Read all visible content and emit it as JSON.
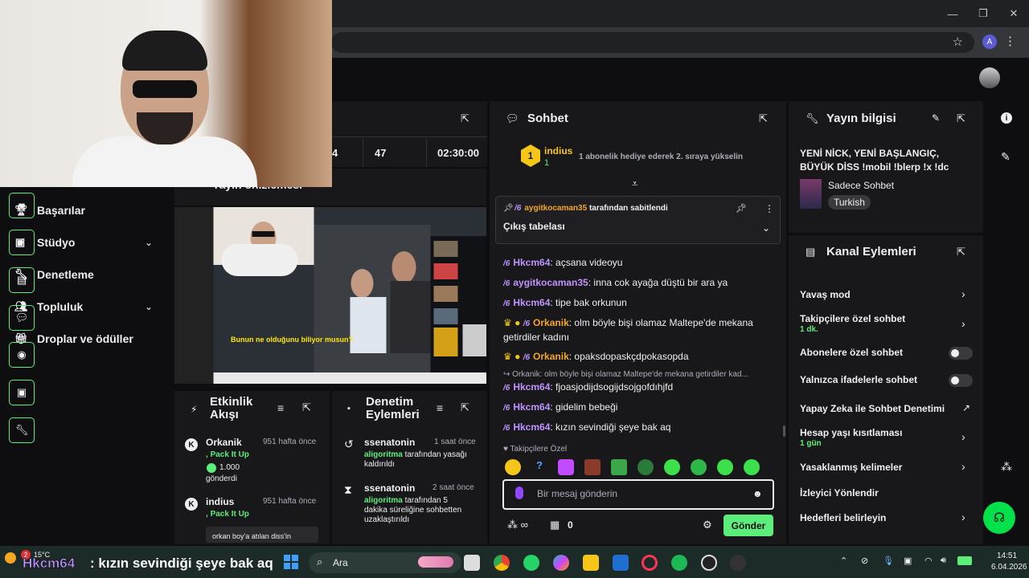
{
  "browser": {
    "window_buttons": [
      "—",
      "❐",
      "✕"
    ],
    "profile_initial": "A"
  },
  "sidebar": {
    "items": [
      {
        "label": "Başarılar",
        "icon": "trophy-icon"
      },
      {
        "label": "Stüdyo",
        "icon": "studio-icon",
        "expandable": true
      },
      {
        "label": "Denetleme",
        "icon": "wrench-icon"
      },
      {
        "label": "Topluluk",
        "icon": "community-icon",
        "expandable": true
      },
      {
        "label": "Droplar ve ödüller",
        "icon": "drops-icon"
      }
    ]
  },
  "stats": {
    "a": "4",
    "b": "47",
    "uptime": "02:30:00"
  },
  "preview": {
    "title_partial": "Yayın önizlemesi",
    "subtitle": "Bunun ne olduğunu biliyor musun?"
  },
  "activity": {
    "title": "Etkinlik Akışı",
    "items": [
      {
        "user": "Orkanik",
        "time": "951 hafta önce",
        "action": "Pack It Up",
        "amount": "1.000",
        "verb": "gönderdi"
      },
      {
        "user": "indius",
        "time": "951 hafta önce",
        "action": "Pack It Up",
        "note": "orkan boy'a atılan diss'in"
      }
    ]
  },
  "mod_actions": {
    "title": "Denetim Eylemleri",
    "items": [
      {
        "user": "ssenatonin",
        "time": "1 saat önce",
        "mod": "aligoritma",
        "text": "tarafından yasağı kaldırıldı"
      },
      {
        "user": "ssenatonin",
        "time": "2 saat önce",
        "mod": "aligoritma",
        "text": "tarafından 5 dakika süreliğine sohbetten uzaklaştırıldı"
      }
    ]
  },
  "chat": {
    "title": "Sohbet",
    "top_gifter": {
      "rank": "1",
      "user": "indius",
      "count": "1",
      "hint": "1 abonelik hediye ederek 2. sıraya yükselin"
    },
    "pinned": {
      "by_user": "aygitkocaman35",
      "by_text": "tarafından sabitlendi",
      "message": "Çıkış tabelası"
    },
    "messages": [
      {
        "user": "Hkcm64",
        "color": "#bf94ff",
        "text": "açsana videoyu",
        "badges": "tw"
      },
      {
        "user": "aygitkocaman35",
        "color": "#bf94ff",
        "text": "inna cok ayağa düştü bir ara ya",
        "badges": "tw"
      },
      {
        "user": "Hkcm64",
        "color": "#bf94ff",
        "text": "tipe bak orkunun",
        "badges": "tw"
      },
      {
        "user": "Orkanik",
        "color": "#f5a623",
        "text": "olm böyle bişi olamaz Maltepe'de mekana getirdiler kadını",
        "badges": "crown"
      },
      {
        "user": "Orkanik",
        "color": "#f5a623",
        "text": "opaksdopaskçdpokasopda",
        "badges": "crown"
      },
      {
        "reply": "Orkanik: olm böyle bişi olamaz Maltepe'de mekana getirdiler kad..."
      },
      {
        "user": "Hkcm64",
        "color": "#bf94ff",
        "text": "fjoasjodijdsogijdsojgofdıhjfd",
        "badges": "tw"
      },
      {
        "user": "Hkcm64",
        "color": "#bf94ff",
        "text": "gidelim bebeği",
        "badges": "tw"
      },
      {
        "user": "Hkcm64",
        "color": "#bf94ff",
        "text": "kızın sevindiği şeye bak aq",
        "badges": "tw"
      }
    ],
    "followers_only": "Takipçilere Özel",
    "input_placeholder": "Bir mesaj gönderin",
    "points": "0",
    "send_label": "Gönder"
  },
  "stream_info": {
    "title": "Yayın bilgisi",
    "stream_title": "YENİ NİCK, YENİ BAŞLANGIÇ, BÜYÜK DİSS !mobil !blerp !x !dc",
    "category": "Sadece Sohbet",
    "tag": "Turkish"
  },
  "channel_actions": {
    "title": "Kanal Eylemleri",
    "items": [
      {
        "label": "Yavaş mod",
        "control": "chevron"
      },
      {
        "label": "Takipçilere özel sohbet",
        "sub": "1 dk.",
        "control": "chevron"
      },
      {
        "label": "Abonelere özel sohbet",
        "control": "toggle"
      },
      {
        "label": "Yalnızca ifadelerle sohbet",
        "control": "toggle"
      },
      {
        "label": "Yapay Zeka ile Sohbet Denetimi",
        "control": "external"
      },
      {
        "label": "Hesap yaşı kısıtlaması",
        "sub": "1 gün",
        "control": "chevron"
      },
      {
        "label": "Yasaklanmış kelimeler",
        "control": "chevron"
      },
      {
        "label": "İzleyici Yönlendir",
        "control": "none"
      },
      {
        "label": "Hedefleri belirleyin",
        "control": "chevron"
      }
    ]
  },
  "taskbar": {
    "weather": "15°C",
    "weather_badge": "2",
    "overlay_user": "Hkcm64",
    "overlay_text": "kızın sevindiği şeye bak aq",
    "search_label": "Ara",
    "time": "14:51",
    "date": "6.04.2026"
  },
  "colors": {
    "accent": "#5ced7a",
    "purple": "#bf94ff",
    "bg": "#0e0e10",
    "panel": "#18181b"
  }
}
